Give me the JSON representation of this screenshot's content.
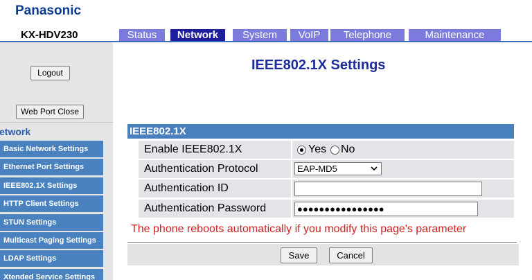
{
  "brand": "Panasonic",
  "model": "KX-HDV230",
  "tabs": [
    {
      "label": "Status"
    },
    {
      "label": "Network"
    },
    {
      "label": "System"
    },
    {
      "label": "VoIP"
    },
    {
      "label": "Telephone"
    },
    {
      "label": "Maintenance"
    }
  ],
  "active_tab": "Network",
  "sidebar": {
    "logout_label": "Logout",
    "webport_label": "Web Port Close",
    "heading": "etwork",
    "items": [
      {
        "label": "Basic Network Settings"
      },
      {
        "label": "Ethernet Port Settings"
      },
      {
        "label": "IEEE802.1X Settings"
      },
      {
        "label": "HTTP Client Settings"
      },
      {
        "label": "STUN Settings"
      },
      {
        "label": "Multicast Paging Settings"
      },
      {
        "label": "LDAP Settings"
      },
      {
        "label": "Xtended Service Settings"
      }
    ]
  },
  "page": {
    "title": "IEEE802.1X Settings",
    "section": "IEEE802.1X"
  },
  "form": {
    "enable_label": "Enable IEEE802.1X",
    "yes_label": "Yes",
    "no_label": "No",
    "enable_value": "Yes",
    "protocol_label": "Authentication Protocol",
    "protocol_value": "EAP-MD5",
    "id_label": "Authentication ID",
    "id_value": "",
    "password_label": "Authentication Password",
    "password_value": "●●●●●●●●●●●●●●●●"
  },
  "warning": "The phone reboots automatically if you modify this page's parameter",
  "buttons": {
    "save": "Save",
    "cancel": "Cancel"
  },
  "colors": {
    "brand": "#0a3d91",
    "tab_active": "#1d1d9e",
    "tab_inactive": "#7b7bde",
    "nav_item": "#4a82c0",
    "section_header": "#4a7fbd",
    "warning": "#d02020"
  }
}
